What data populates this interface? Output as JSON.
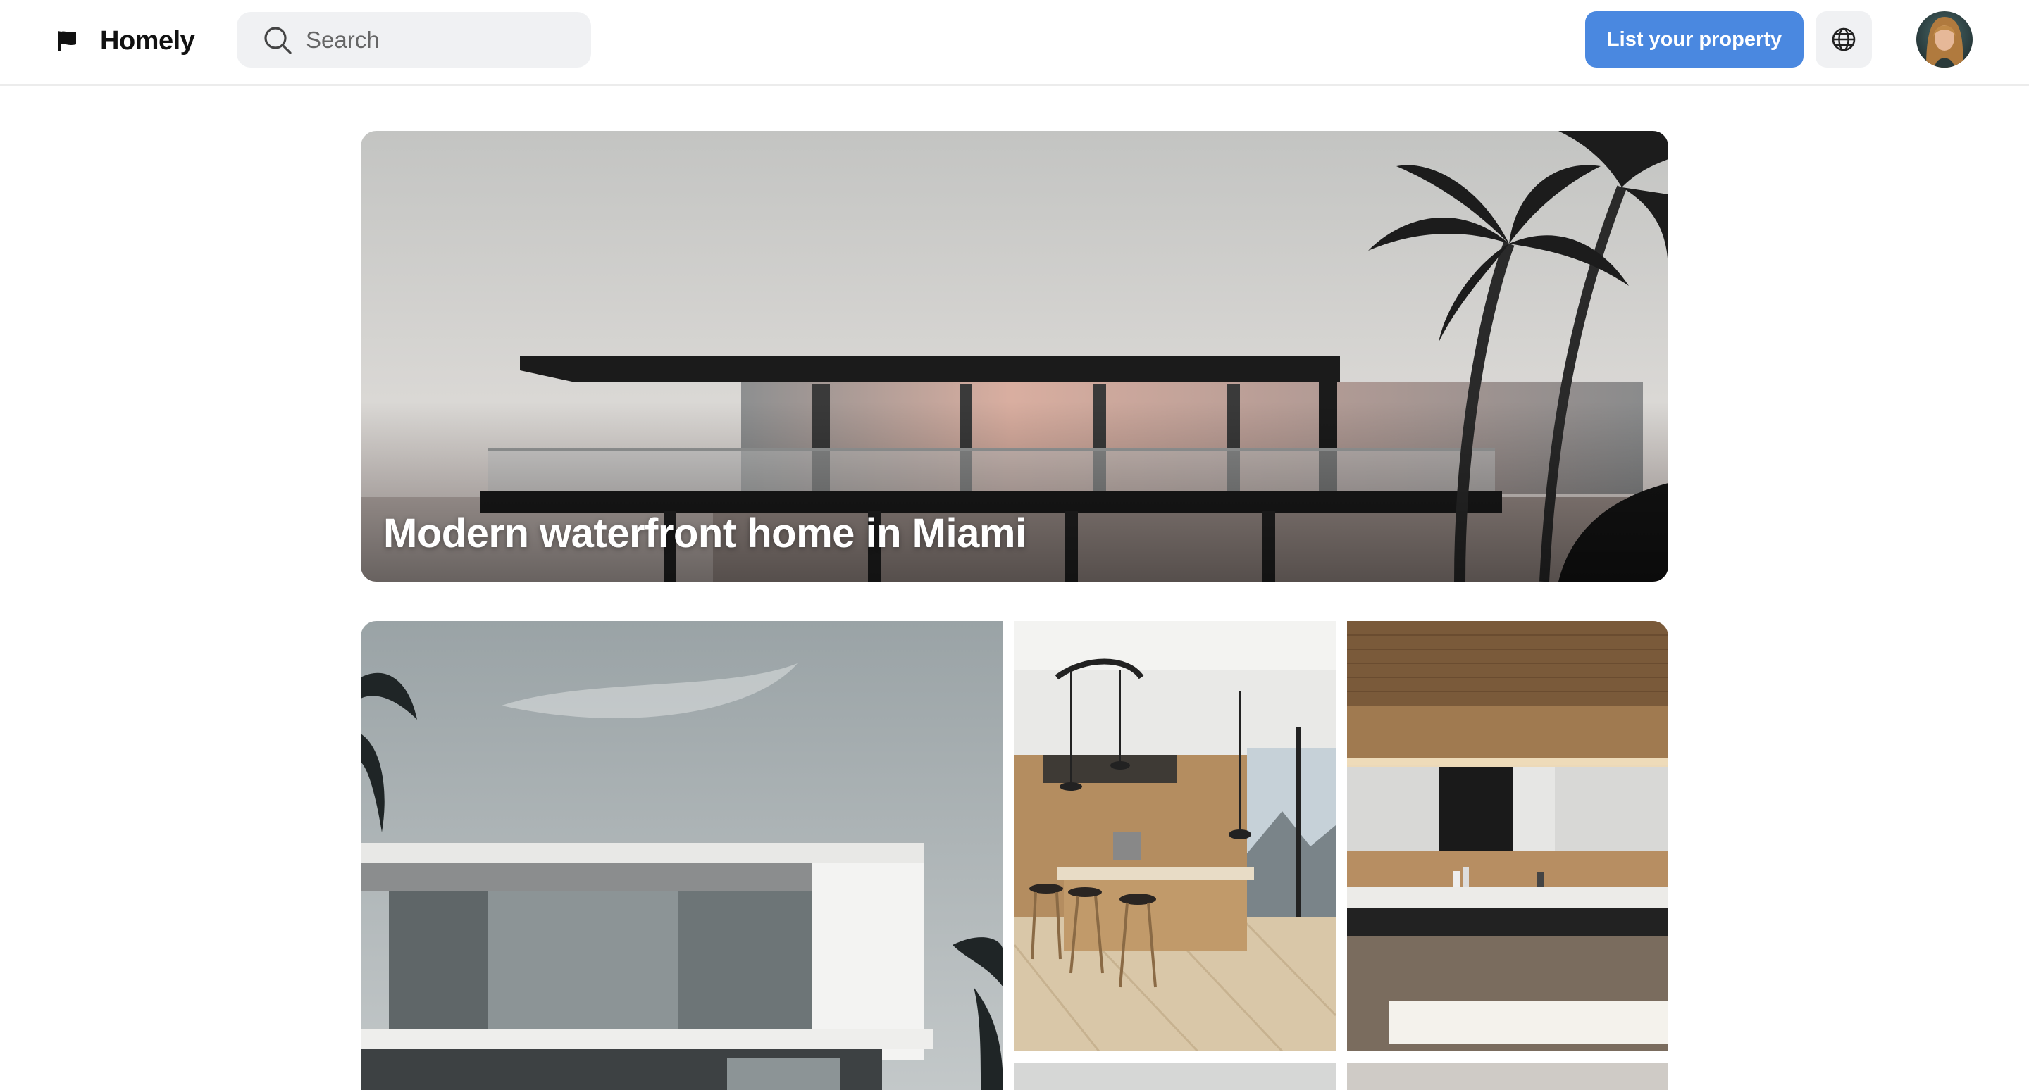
{
  "header": {
    "brand": "Homely",
    "search_placeholder": "Search",
    "list_property_label": "List your property"
  },
  "icons": {
    "logo": "flag-icon",
    "search": "search-icon",
    "language": "globe-icon",
    "avatar": "avatar"
  },
  "hero": {
    "title": "Modern waterfront home in Miami"
  },
  "gallery": {
    "tiles": [
      "exterior-facade-photo",
      "kitchen-photo",
      "bathroom-photo",
      "photo",
      "photo"
    ]
  },
  "colors": {
    "accent": "#4a88e0",
    "surface": "#f0f1f3",
    "text": "#111111"
  }
}
